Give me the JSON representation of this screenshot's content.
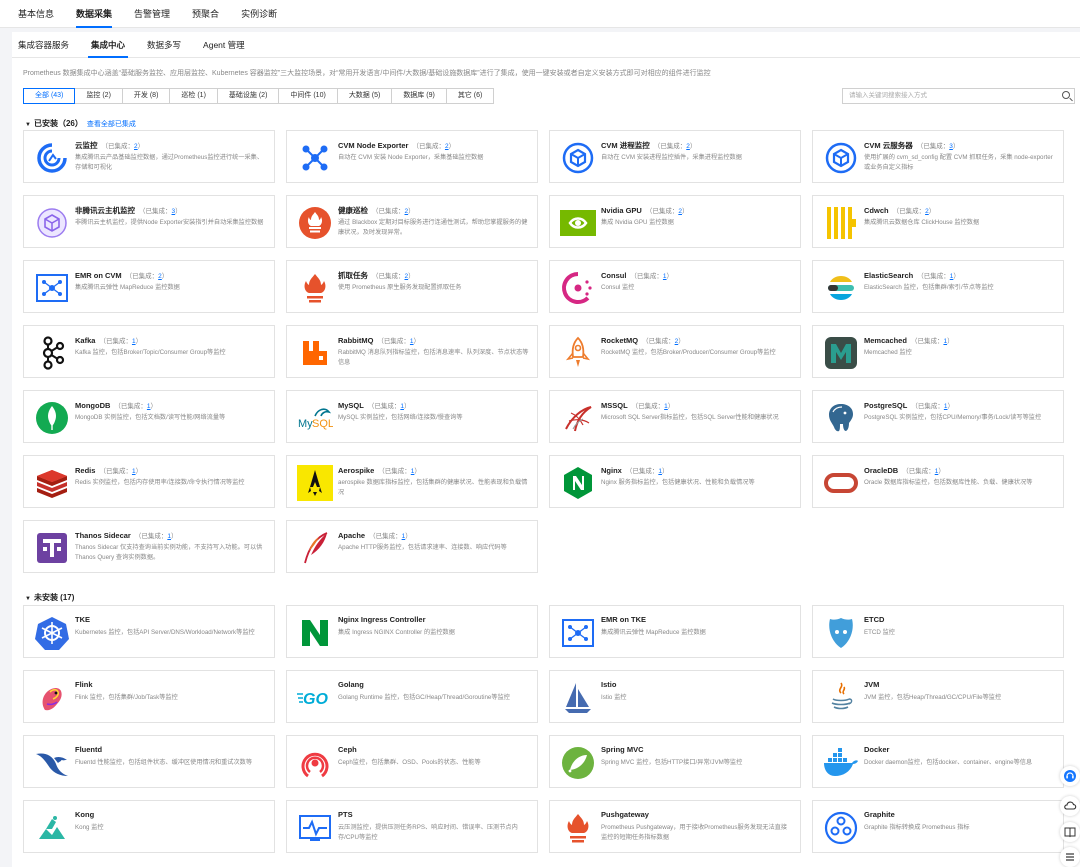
{
  "top_tabs": [
    "基本信息",
    "数据采集",
    "告警管理",
    "预聚合",
    "实例诊断"
  ],
  "sub_tabs": [
    "集成容器服务",
    "集成中心",
    "数据多写",
    "Agent 管理"
  ],
  "description": "Prometheus 数据集成中心涵盖“基础服务监控、应用层监控、Kubernetes 容器监控”三大监控场景，对“常用开发语言/中间件/大数据/基础设施数据库”进行了集成，使用一键安装或者自定义安装方式即可对相应的组件进行监控",
  "filters": [
    "全部 (43)",
    "监控 (2)",
    "开发 (8)",
    "巡检 (1)",
    "基础设施 (2)",
    "中间件 (10)",
    "大数据 (5)",
    "数据库 (9)",
    "其它 (6)"
  ],
  "search_placeholder": "请输入关键词搜索接入方式",
  "installed": {
    "title": "已安装（26）",
    "link": "查看全部已集成"
  },
  "uninstalled": {
    "title": "未安装 (17)"
  },
  "count_prefix": "（已集成：",
  "count_suffix": "）",
  "installed_items": [
    {
      "name": "云监控",
      "count": "2",
      "desc": "集成腾讯云产品基础监控数据，通过Prometheus监控进行统一采集、存储和可视化",
      "icon": "cloud-monitor-icon"
    },
    {
      "name": "CVM Node Exporter",
      "count": "2",
      "desc": "自动在 CVM 安装 Node Exporter，采集基础监控数据",
      "icon": "node-exporter-icon"
    },
    {
      "name": "CVM 进程监控",
      "count": "2",
      "desc": "自动在 CVM 安装进程监控插件，采集进程监控数据",
      "icon": "process-monitor-icon"
    },
    {
      "name": "CVM 云服务器",
      "count": "3",
      "desc": "使用扩展的 cvm_sd_config 配置 CVM 抓取任务，采集 node-exporter 或业务自定义指标",
      "icon": "cvm-server-icon"
    },
    {
      "name": "非腾讯云主机监控",
      "count": "3",
      "desc": "非腾讯云主机监控，提供Node Exporter安装指引并自动采集监控数据",
      "icon": "external-host-icon"
    },
    {
      "name": "健康巡检",
      "count": "2",
      "desc": "通过 Blackbox 定期对目标服务进行连通性测试，帮助您掌握服务的健康状况，及时发现异常。",
      "icon": "health-check-icon"
    },
    {
      "name": "Nvidia GPU",
      "count": "2",
      "desc": "集成 Nvidia GPU 监控数据",
      "icon": "nvidia-icon"
    },
    {
      "name": "Cdwch",
      "count": "2",
      "desc": "集成腾讯云数据仓库 ClickHouse 监控数据",
      "icon": "clickhouse-icon"
    },
    {
      "name": "EMR on CVM",
      "count": "2",
      "desc": "集成腾讯云弹性 MapReduce 监控数据",
      "icon": "emr-icon"
    },
    {
      "name": "抓取任务",
      "count": "2",
      "desc": "使用 Prometheus 原生服务发现配置抓取任务",
      "icon": "prometheus-icon"
    },
    {
      "name": "Consul",
      "count": "1",
      "desc": "Consul 监控",
      "icon": "consul-icon"
    },
    {
      "name": "ElasticSearch",
      "count": "1",
      "desc": "ElasticSearch 监控，包括集群/索引/节点等监控",
      "icon": "elasticsearch-icon"
    },
    {
      "name": "Kafka",
      "count": "1",
      "desc": "Kafka 监控，包括Broker/Topic/Consumer Group等监控",
      "icon": "kafka-icon"
    },
    {
      "name": "RabbitMQ",
      "count": "1",
      "desc": "RabbitMQ 消息队列指标监控，包括消息速率、队列深度、节点状态等信息",
      "icon": "rabbitmq-icon"
    },
    {
      "name": "RocketMQ",
      "count": "2",
      "desc": "RocketMQ 监控，包括Broker/Producer/Consumer Group等监控",
      "icon": "rocketmq-icon"
    },
    {
      "name": "Memcached",
      "count": "1",
      "desc": "Memcached 监控",
      "icon": "memcached-icon"
    },
    {
      "name": "MongoDB",
      "count": "1",
      "desc": "MongoDB 实例监控，包括文档数/读写性能/网络流量等",
      "icon": "mongodb-icon"
    },
    {
      "name": "MySQL",
      "count": "1",
      "desc": "MySQL 实例监控，包括网络/连接数/慢查询等",
      "icon": "mysql-icon"
    },
    {
      "name": "MSSQL",
      "count": "1",
      "desc": "Microsoft SQL Server指标监控，包括SQL Server性能和健康状况",
      "icon": "mssql-icon"
    },
    {
      "name": "PostgreSQL",
      "count": "1",
      "desc": "PostgreSQL 实例监控，包括CPU/Memory/事务/Lock/读写等监控",
      "icon": "postgresql-icon"
    },
    {
      "name": "Redis",
      "count": "1",
      "desc": "Redis 实例监控，包括内存使用率/连接数/命令执行情况等监控",
      "icon": "redis-icon"
    },
    {
      "name": "Aerospike",
      "count": "1",
      "desc": "aerospike 数据库指标监控，包括集群的健康状况、性能表现和负载情况",
      "icon": "aerospike-icon"
    },
    {
      "name": "Nginx",
      "count": "1",
      "desc": "Nginx 服务指标监控，包括健康状况、性能和负载情况等",
      "icon": "nginx-icon"
    },
    {
      "name": "OracleDB",
      "count": "1",
      "desc": "Oracle 数据库指标监控，包括数据库性能、负载、健康状况等",
      "icon": "oracle-icon"
    },
    {
      "name": "Thanos Sidecar",
      "count": "1",
      "desc": "Thanos Sidecar 仅支持查询当前实例功能，不支持写入功能。可以供 Thanos Query 查询实例数据。",
      "icon": "thanos-icon"
    },
    {
      "name": "Apache",
      "count": "1",
      "desc": "Apache HTTP服务监控，包括请求速率、连接数、响应代码等",
      "icon": "apache-icon"
    }
  ],
  "uninstalled_items": [
    {
      "name": "TKE",
      "desc": "Kubernetes 监控，包括API Server/DNS/Workload/Network等监控",
      "icon": "kubernetes-icon"
    },
    {
      "name": "Nginx Ingress Controller",
      "desc": "集成 Ingress NGINX Controller 的监控数据",
      "icon": "nginx-ingress-icon"
    },
    {
      "name": "EMR on TKE",
      "desc": "集成腾讯云弹性 MapReduce 监控数据",
      "icon": "emr-icon"
    },
    {
      "name": "ETCD",
      "desc": "ETCD 监控",
      "icon": "etcd-icon"
    },
    {
      "name": "Flink",
      "desc": "Flink 监控，包括集群/Job/Task等监控",
      "icon": "flink-icon"
    },
    {
      "name": "Golang",
      "desc": "Golang Runtime 监控，包括GC/Heap/Thread/Goroutine等监控",
      "icon": "golang-icon"
    },
    {
      "name": "Istio",
      "desc": "Istio 监控",
      "icon": "istio-icon"
    },
    {
      "name": "JVM",
      "desc": "JVM 监控，包括Heap/Thread/GC/CPU/File等监控",
      "icon": "java-icon"
    },
    {
      "name": "Fluentd",
      "desc": "Fluentd 性能监控，包括组件状态、缓冲区使用情况和重试次数等",
      "icon": "fluentd-icon"
    },
    {
      "name": "Ceph",
      "desc": "Ceph监控，包括集群、OSD、Pools的状态、性能等",
      "icon": "ceph-icon"
    },
    {
      "name": "Spring MVC",
      "desc": "Spring MVC 监控，包括HTTP接口/异常/JVM等监控",
      "icon": "spring-icon"
    },
    {
      "name": "Docker",
      "desc": "Docker daemon监控，包括docker、container、engine等信息",
      "icon": "docker-icon"
    },
    {
      "name": "Kong",
      "desc": "Kong 监控",
      "icon": "kong-icon"
    },
    {
      "name": "PTS",
      "desc": "云压测监控，提供压测任务RPS、响应时间、错误率、压测节点内存/CPU等监控",
      "icon": "pts-icon"
    },
    {
      "name": "Pushgateway",
      "desc": "Prometheus Pushgateway，用于接收Prometheus服务发现无法直接监控的短期任务指标数据",
      "icon": "prometheus-icon"
    },
    {
      "name": "Graphite",
      "desc": "Graphite 指标转换成 Prometheus 指标",
      "icon": "graphite-icon"
    }
  ]
}
